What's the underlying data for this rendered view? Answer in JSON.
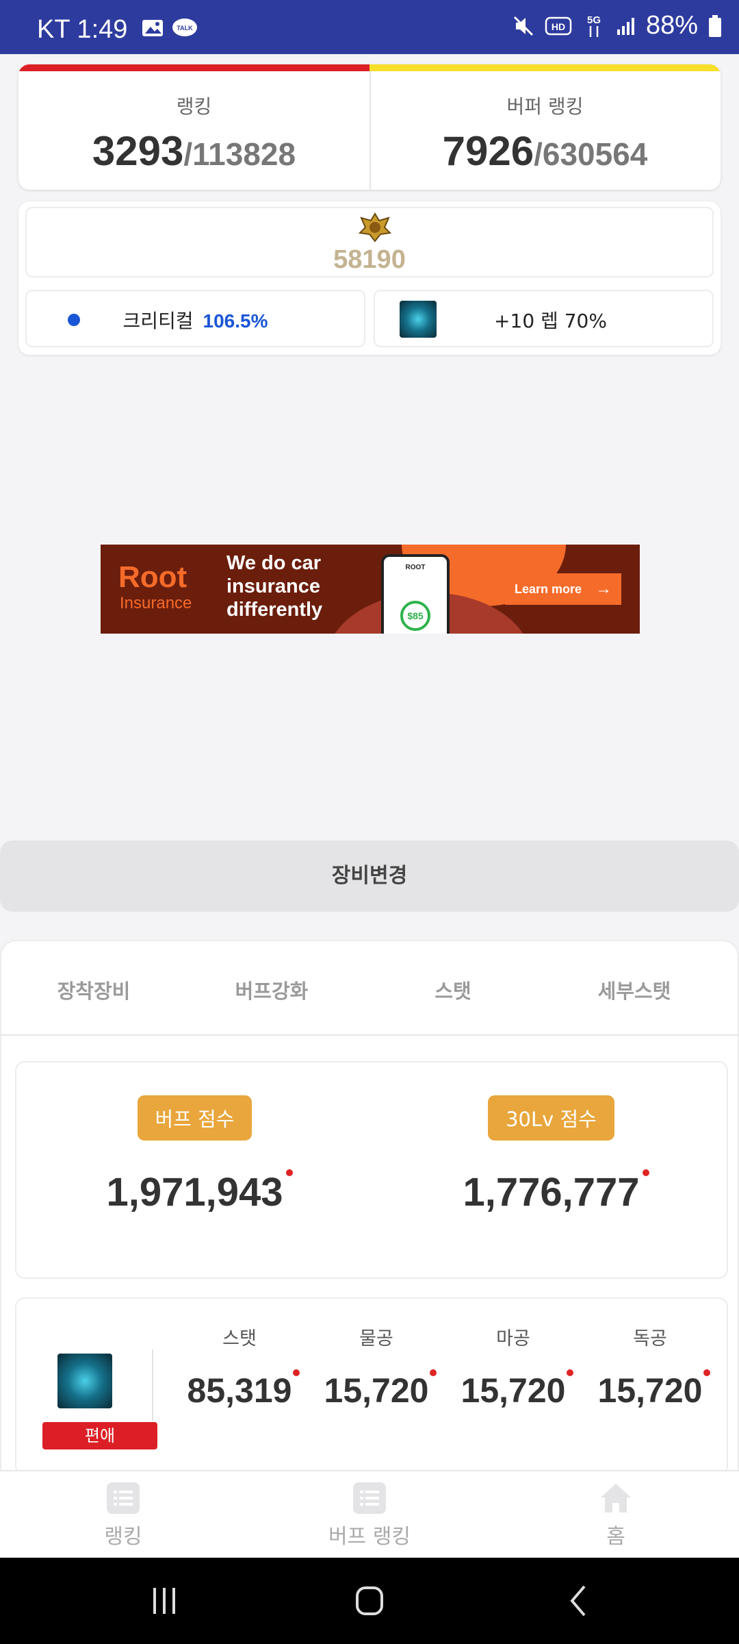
{
  "status_bar": {
    "carrier_time": "KT 1:49",
    "battery": "88%",
    "network": "5G",
    "icons": [
      "gallery-icon",
      "kakaotalk-icon",
      "mute-icon",
      "hd-icon",
      "5g-icon",
      "signal-icon",
      "battery-icon"
    ]
  },
  "ranking": {
    "label": "랭킹",
    "rank": "3293",
    "total": "/113828",
    "buffer_label": "버퍼 랭킹",
    "buffer_rank": "7926",
    "buffer_total": "/630564",
    "colors": {
      "left_bar": "#dc1f26",
      "right_bar": "#f7df2a"
    }
  },
  "score": {
    "value": "58190",
    "critical_label": "크리티컬",
    "critical_value": "106.5%",
    "pet_text": "+10 렙 70%"
  },
  "ad": {
    "brand": "Root",
    "brand_sub": "Insurance",
    "headline": "We do car insurance differently",
    "phone_logo": "ROOT",
    "phone_amount": "$85",
    "cta": "Learn more"
  },
  "equip_button": "장비변경",
  "tabs": [
    "장착장비",
    "버프강화",
    "스탯",
    "세부스탯"
  ],
  "buff_scores": {
    "buff_label": "버프 점수",
    "buff_value": "1,971,943",
    "lv30_label": "30Lv 점수",
    "lv30_value": "1,776,777",
    "accent": "#e8a63c"
  },
  "stats": {
    "tag": "편애",
    "headers": [
      "스탯",
      "물공",
      "마공",
      "독공"
    ],
    "values": [
      "85,319",
      "15,720",
      "15,720",
      "15,720"
    ]
  },
  "bottom_nav": [
    "랭킹",
    "버프 랭킹",
    "홈"
  ]
}
